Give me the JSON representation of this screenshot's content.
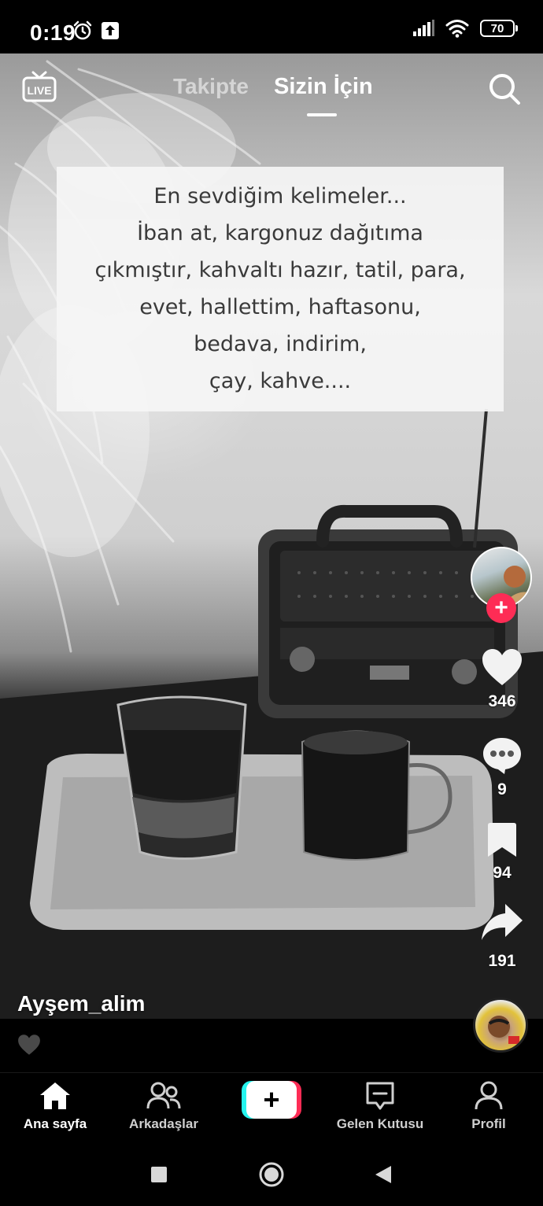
{
  "status_bar": {
    "time": "0:19",
    "battery": "70",
    "icons": [
      "alarm-icon",
      "upload-icon",
      "signal-icon",
      "wifi-icon",
      "battery-icon"
    ]
  },
  "top_nav": {
    "live_label": "LIVE",
    "tabs": [
      {
        "label": "Takipte",
        "active": false
      },
      {
        "label": "Sizin İçin",
        "active": true
      }
    ],
    "search_icon": "search-icon"
  },
  "video": {
    "caption_lines": [
      "En sevdiğim kelimeler...",
      "İban at, kargonuz dağıtıma",
      "çıkmıştır, kahvaltı hazır, tatil, para,",
      "evet, hallettim, haftasonu,",
      "bedava, indirim,",
      "çay, kahve...."
    ],
    "author": "Ayşem_alim"
  },
  "actions": {
    "likes": "346",
    "comments": "9",
    "saves": "94",
    "shares": "191",
    "follow_icon": "plus-icon"
  },
  "tabbar": {
    "items": [
      {
        "label": "Ana sayfa",
        "icon": "home-icon",
        "active": true
      },
      {
        "label": "Arkadaşlar",
        "icon": "friends-icon",
        "active": false
      },
      {
        "label": "",
        "icon": "create-icon",
        "active": false
      },
      {
        "label": "Gelen Kutusu",
        "icon": "inbox-icon",
        "active": false
      },
      {
        "label": "Profil",
        "icon": "profile-icon",
        "active": false
      }
    ]
  },
  "colors": {
    "accent_red": "#fe2c55",
    "accent_cyan": "#25f4ee",
    "background": "#000000"
  }
}
